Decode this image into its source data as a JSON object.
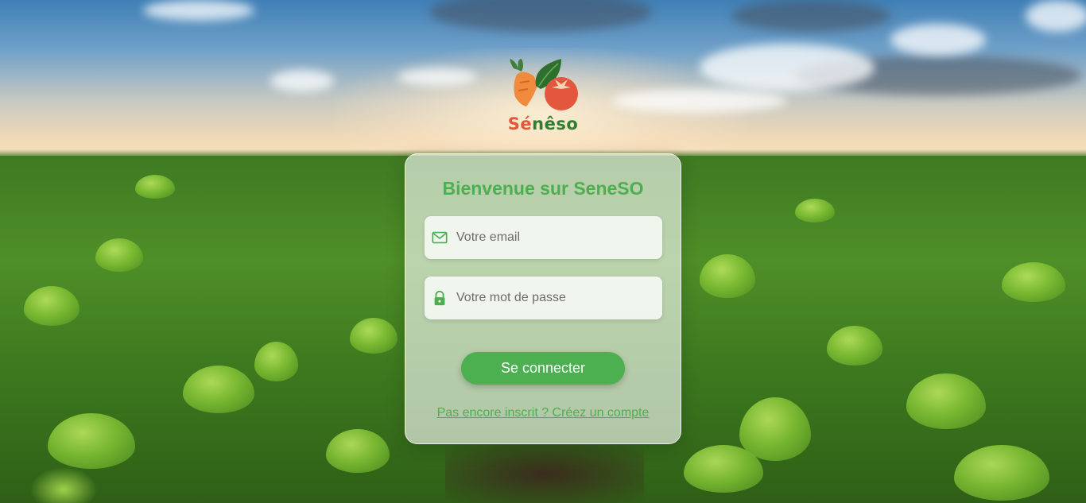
{
  "brand": {
    "logo_text_part1": "Sé",
    "logo_text_part2": "nêso",
    "colors": {
      "red": "#e2573d",
      "green": "#2e7d32",
      "leaf": "#3f7f3a",
      "carrot": "#f08a3c"
    }
  },
  "login": {
    "title": "Bienvenue sur SeneSO",
    "email": {
      "placeholder": "Votre email",
      "value": "",
      "icon": "mail-icon"
    },
    "password": {
      "placeholder": "Votre mot de passe",
      "value": "",
      "icon": "lock-icon"
    },
    "submit_label": "Se connecter",
    "signup_link": "Pas encore inscrit ? Créez un compte"
  },
  "theme": {
    "accent": "#4caf50"
  }
}
